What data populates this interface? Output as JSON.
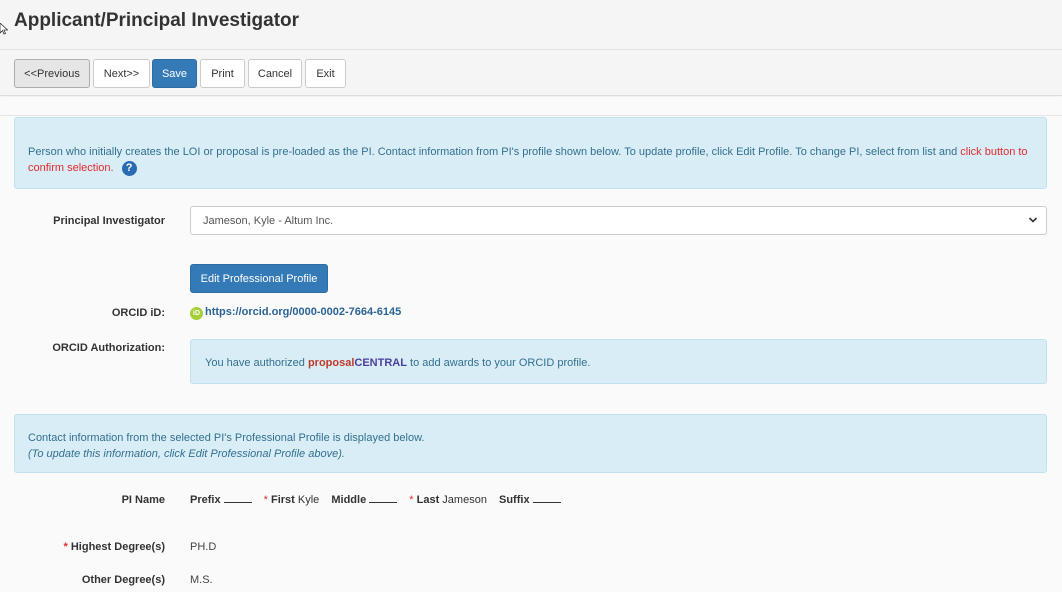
{
  "page": {
    "title": "Applicant/Principal Investigator"
  },
  "toolbar": {
    "previous": "<<Previous",
    "next": "Next>>",
    "save": "Save",
    "print": "Print",
    "cancel": "Cancel",
    "exit": "Exit"
  },
  "info_alert": {
    "text": "Person who initially creates the LOI or proposal is pre-loaded as the PI. Contact information from PI's profile shown below. To update profile, click Edit Profile. To change PI, select from list and ",
    "highlight": "click button to confirm selection.",
    "help_icon": "?"
  },
  "pi": {
    "label": "Principal Investigator",
    "selected": "Jameson, Kyle - Altum Inc.",
    "edit_profile_button": "Edit Professional Profile"
  },
  "orcid": {
    "id_label": "ORCID iD:",
    "icon_text": "iD",
    "link": "https://orcid.org/0000-0002-7664-6145",
    "auth_label": "ORCID Authorization:",
    "auth_text_before": "You have authorized ",
    "brand_part1": "proposal",
    "brand_part2": "CENTRAL",
    "auth_text_after": " to add awards to your ORCID profile."
  },
  "contact_alert": {
    "line1": "Contact information from the selected PI's Professional Profile is displayed below.",
    "line2": "(To update this information, click Edit Professional Profile above)."
  },
  "pi_name": {
    "label": "PI Name",
    "prefix_label": "Prefix",
    "first_label": "First",
    "first_value": "Kyle",
    "middle_label": "Middle",
    "last_label": "Last",
    "last_value": "Jameson",
    "suffix_label": "Suffix",
    "required_mark": "*"
  },
  "degrees": {
    "highest_label": "Highest Degree(s)",
    "highest_value": "PH.D",
    "other_label": "Other Degree(s)",
    "other_value": "M.S."
  }
}
